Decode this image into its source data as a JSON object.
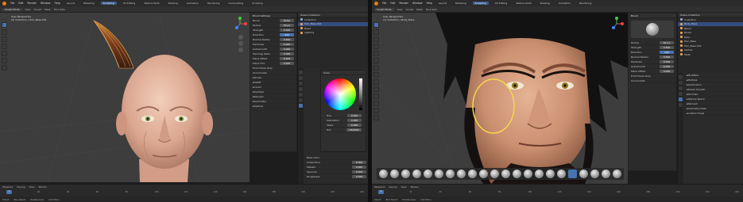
{
  "left": {
    "menu": [
      "File",
      "Edit",
      "Render",
      "Window",
      "Help"
    ],
    "workspaces": [
      "Layout",
      "Modeling",
      "Sculpting",
      "UV Editing",
      "Texture Paint",
      "Shading",
      "Animation",
      "Rendering",
      "Compositing",
      "Scripting"
    ],
    "active_workspace": "Sculpting",
    "tool_header": [
      "Sculpt Mode",
      "View",
      "Sculpt",
      "Mask",
      "Face Sets"
    ],
    "viewport_info": [
      "User Perspective",
      "(0) Collection | Hair_Base.001"
    ],
    "brush_panel_title": "Brush Settings",
    "brush_rows": [
      {
        "label": "Brush",
        "value": "Draw",
        "active": false
      },
      {
        "label": "Radius",
        "value": "50 px",
        "active": false
      },
      {
        "label": "Strength",
        "value": "0.500",
        "active": false
      },
      {
        "label": "Direction",
        "value": "Add",
        "active": true
      },
      {
        "label": "Normal Radius",
        "value": "0.500",
        "active": false
      },
      {
        "label": "Hardness",
        "value": "0.000",
        "active": false
      },
      {
        "label": "Autosmooth",
        "value": "0.000",
        "active": false
      },
      {
        "label": "Topology Rake",
        "value": "0.000",
        "active": false
      },
      {
        "label": "Plane Offset",
        "value": "0.000",
        "active": false
      },
      {
        "label": "Plane Trim",
        "value": "0.500",
        "active": false
      },
      {
        "label": "Front Faces Only",
        "value": "",
        "active": true
      },
      {
        "label": "Accumulate",
        "value": "",
        "active": false
      }
    ],
    "brush_sections": [
      "Stroke",
      "Falloff",
      "Cursor",
      "Dyntopo",
      "Remesh",
      "Symmetry",
      "Options"
    ],
    "outliner": [
      {
        "name": "Scene Collection",
        "selected": false
      },
      {
        "name": "Collection",
        "selected": false
      },
      {
        "name": "Hair_Base.001",
        "selected": true
      },
      {
        "name": "Head",
        "selected": false
      },
      {
        "name": "Lighting",
        "selected": false
      }
    ],
    "color_panel_title": "Color",
    "color_rows": [
      {
        "label": "Hue",
        "value": "0.000"
      },
      {
        "label": "Saturation",
        "value": "0.000"
      },
      {
        "label": "Value",
        "value": "0.836"
      },
      {
        "label": "Hex",
        "value": "D5D5D5"
      }
    ],
    "material_rows": [
      {
        "label": "Base Color",
        "value": ""
      },
      {
        "label": "Subsurface",
        "value": "0.000"
      },
      {
        "label": "Metallic",
        "value": "0.000"
      },
      {
        "label": "Specular",
        "value": "0.500"
      },
      {
        "label": "Roughness",
        "value": "0.500"
      }
    ],
    "timeline_menu": [
      "Playback",
      "Keying",
      "View",
      "Marker"
    ],
    "frame": "1",
    "ticks": [
      "0",
      "20",
      "40",
      "60",
      "80",
      "100",
      "120",
      "140",
      "160",
      "180",
      "200",
      "220",
      "240"
    ],
    "status": [
      "Select",
      "Box Select",
      "Rotate View",
      "Call Menu"
    ]
  },
  "right": {
    "menu": [
      "File",
      "Edit",
      "Render",
      "Window",
      "Help"
    ],
    "workspaces": [
      "Layout",
      "Modeling",
      "Sculpting",
      "UV Editing",
      "Texture Paint",
      "Shading",
      "Animation",
      "Rendering"
    ],
    "active_workspace": "Sculpting",
    "tool_header": [
      "Sculpt Mode",
      "View",
      "Sculpt",
      "Mask",
      "Face Sets"
    ],
    "viewport_info": [
      "User Perspective",
      "(1) Collection | Body_Base"
    ],
    "brush_panel_title": "Brush",
    "brush_rows": [
      {
        "label": "Radius",
        "value": "62 px",
        "active": false
      },
      {
        "label": "Strength",
        "value": "0.500",
        "active": false
      },
      {
        "label": "Direction",
        "value": "Add",
        "active": true
      },
      {
        "label": "Normal Radius",
        "value": "0.500",
        "active": false
      },
      {
        "label": "Hardness",
        "value": "0.000",
        "active": false
      },
      {
        "label": "Autosmooth",
        "value": "0.000",
        "active": false
      },
      {
        "label": "Plane Offset",
        "value": "0.000",
        "active": false
      },
      {
        "label": "Front Faces Only",
        "value": "",
        "active": false
      },
      {
        "label": "Accumulate",
        "value": "",
        "active": false
      }
    ],
    "outliner": [
      {
        "name": "Scene Collection",
        "selected": false
      },
      {
        "name": "Collection",
        "selected": false
      },
      {
        "name": "Body_Base",
        "selected": true
      },
      {
        "name": "Beard",
        "selected": false
      },
      {
        "name": "Brows",
        "selected": false
      },
      {
        "name": "Eyes",
        "selected": false
      },
      {
        "name": "Hair_Base",
        "selected": false
      },
      {
        "name": "Hair_Base.001",
        "selected": false
      },
      {
        "name": "Lashes",
        "selected": false
      },
      {
        "name": "Teeth",
        "selected": false
      }
    ],
    "prop_sections": [
      "Modifiers",
      "Multires",
      "Subdivision",
      "Shade Smooth",
      "Normals",
      "Texture Space",
      "Remesh",
      "Geometry Data",
      "Custom Props"
    ],
    "timeline_menu": [
      "Playback",
      "Keying",
      "View",
      "Marker"
    ],
    "frame": "1",
    "ticks": [
      "0",
      "20",
      "40",
      "60",
      "80",
      "100",
      "120",
      "140",
      "160",
      "180",
      "200",
      "220",
      "240"
    ],
    "status": [
      "Select",
      "Box Select",
      "Rotate View",
      "Call Menu"
    ]
  }
}
